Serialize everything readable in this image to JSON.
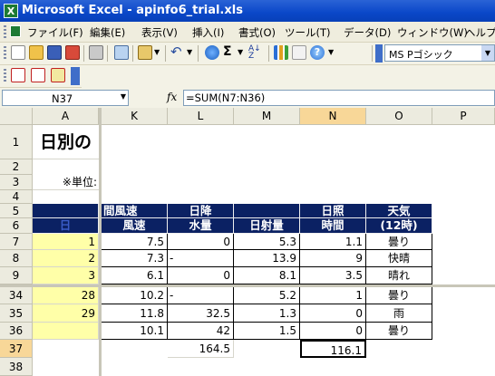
{
  "window": {
    "title": "Microsoft Excel - apinfo6_trial.xls",
    "app_icon": "X"
  },
  "menu": [
    "ファイル(F)",
    "編集(E)",
    "表示(V)",
    "挿入(I)",
    "書式(O)",
    "ツール(T)",
    "データ(D)",
    "ウィンドウ(W)",
    "ヘルプ"
  ],
  "toolbar": {
    "font_name": "MS Pゴシック",
    "sigma": "Σ"
  },
  "formula_bar": {
    "name_box": "N37",
    "fx": "fx",
    "formula": "=SUM(N7:N36)"
  },
  "columns": [
    "A",
    "K",
    "L",
    "M",
    "N",
    "O",
    "P"
  ],
  "rows": [
    "1",
    "2",
    "3",
    "4",
    "5",
    "6",
    "7",
    "8",
    "9",
    "34",
    "35",
    "36",
    "37",
    "38"
  ],
  "sheet": {
    "title": "日別の",
    "unit_label": "※単位:",
    "headers": {
      "k5": "間風速",
      "k6": "風速",
      "l5": "日降",
      "l6": "水量",
      "m6": "日射量",
      "n5": "日照",
      "n6": "時間",
      "o5": "天気",
      "o6": "(12時)",
      "a6": "日"
    },
    "data_rows": [
      {
        "day": "1",
        "wind": "7.5",
        "rain": "0",
        "solar": "5.3",
        "sun": "1.1",
        "weather": "曇り"
      },
      {
        "day": "2",
        "wind": "7.3",
        "rain": "-",
        "solar": "13.9",
        "sun": "9",
        "weather": "快晴"
      },
      {
        "day": "3",
        "wind": "6.1",
        "rain": "0",
        "solar": "8.1",
        "sun": "3.5",
        "weather": "晴れ"
      },
      {
        "day": "28",
        "wind": "10.2",
        "rain": "-",
        "solar": "5.2",
        "sun": "1",
        "weather": "曇り"
      },
      {
        "day": "29",
        "wind": "11.8",
        "rain": "32.5",
        "solar": "1.3",
        "sun": "0",
        "weather": "雨"
      },
      {
        "day": "",
        "wind": "10.1",
        "rain": "42",
        "solar": "1.5",
        "sun": "0",
        "weather": "曇り"
      }
    ],
    "totals": {
      "rain": "164.5",
      "sun": "116.1"
    }
  }
}
